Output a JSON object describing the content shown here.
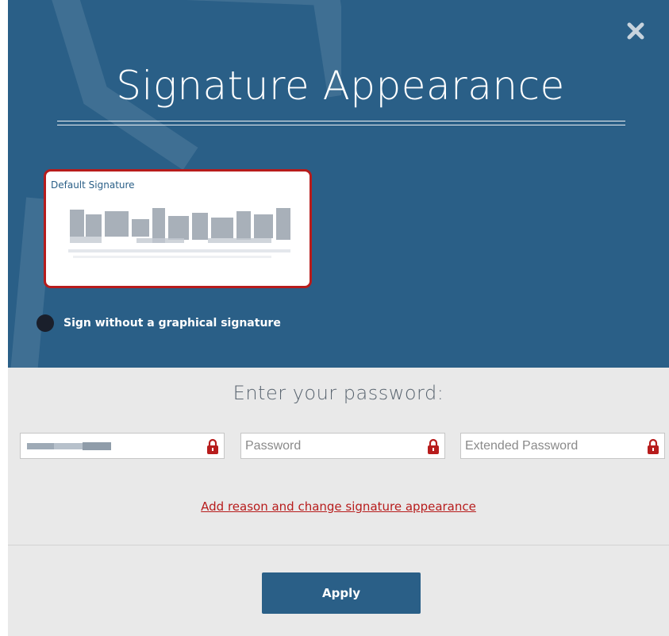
{
  "dialog": {
    "title": "Signature Appearance",
    "close_icon": "close-icon"
  },
  "signature": {
    "card_label": "Default Signature",
    "no_graphic_label": "Sign without a graphical signature"
  },
  "password": {
    "heading": "Enter your password:",
    "fields": [
      {
        "placeholder": "",
        "value": "",
        "icon": "lock-icon"
      },
      {
        "placeholder": "Password",
        "value": "",
        "icon": "lock-icon"
      },
      {
        "placeholder": "Extended Password",
        "value": "",
        "icon": "lock-icon"
      }
    ]
  },
  "links": {
    "reason": "Add reason and change signature appearance"
  },
  "actions": {
    "apply": "Apply"
  },
  "colors": {
    "header_bg": "#2a5f87",
    "accent_red": "#b71c1c",
    "body_bg": "#e9e9e9"
  }
}
